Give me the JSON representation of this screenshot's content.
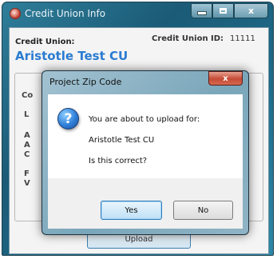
{
  "main_window": {
    "title": "Credit Union Info",
    "credit_union_label": "Credit Union:",
    "credit_union_name": "Aristotle Test CU",
    "credit_union_id_label": "Credit Union ID:",
    "credit_union_id_value": "11111",
    "upload_label": "Upload",
    "partial_labels": [
      "Co",
      "L",
      "A",
      "A",
      "C",
      "F",
      "V"
    ]
  },
  "dialog": {
    "title": "Project Zip Code",
    "close_glyph": "x",
    "icon": "question-icon",
    "icon_glyph": "?",
    "message_line1": "You are about to upload for:",
    "message_line2": "Aristotle Test CU",
    "message_line3": "Is this correct?",
    "yes_label": "Yes",
    "no_label": "No"
  }
}
